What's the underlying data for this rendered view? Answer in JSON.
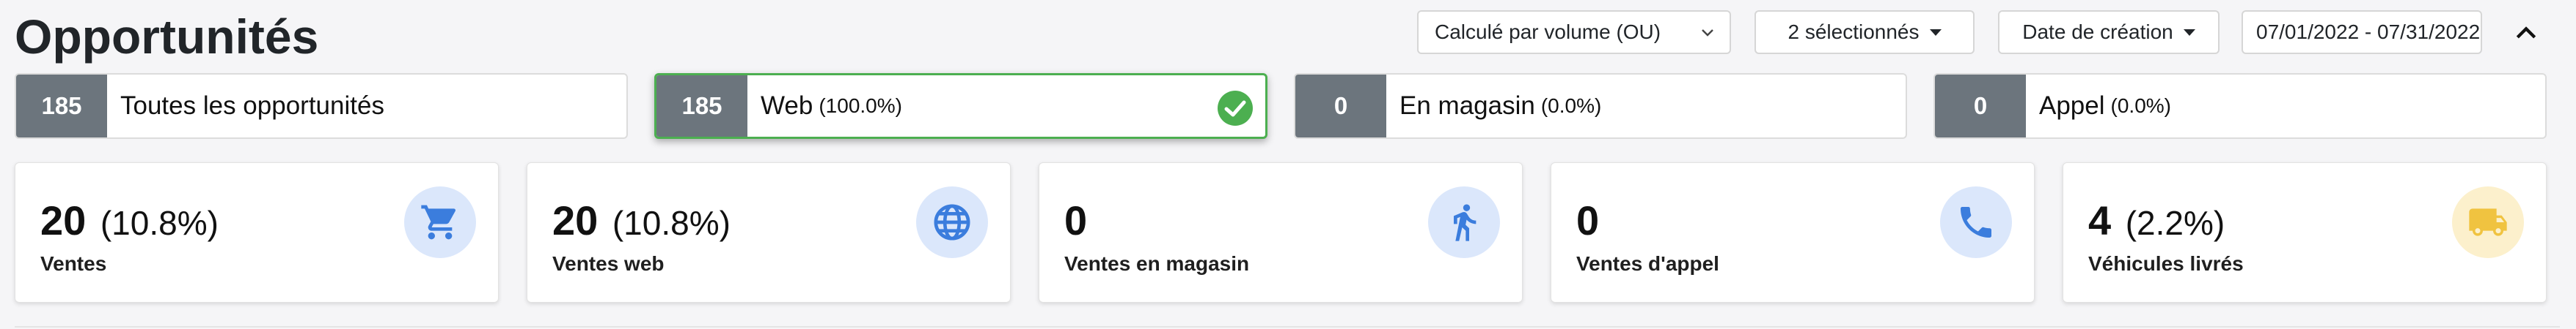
{
  "header": {
    "title": "Opportunités",
    "volume_select": "Calculé par volume (OU)",
    "selected_dropdown": "2 sélectionnés",
    "date_type_dropdown": "Date de création",
    "date_range": "07/01/2022 - 07/31/2022"
  },
  "tiles": [
    {
      "count": "185",
      "label": "Toutes les opportunités",
      "pct": "",
      "active": false
    },
    {
      "count": "185",
      "label": "Web",
      "pct": "(100.0%)",
      "active": true
    },
    {
      "count": "0",
      "label": "En magasin",
      "pct": "(0.0%)",
      "active": false
    },
    {
      "count": "0",
      "label": "Appel",
      "pct": "(0.0%)",
      "active": false
    }
  ],
  "cards": [
    {
      "value": "20",
      "pct": "(10.8%)",
      "label": "Ventes",
      "icon": "cart-icon",
      "icon_color": "#3b7ddd",
      "circle_color": "#dbe7fb"
    },
    {
      "value": "20",
      "pct": "(10.8%)",
      "label": "Ventes web",
      "icon": "globe-icon",
      "icon_color": "#3b7ddd",
      "circle_color": "#dbe7fb"
    },
    {
      "value": "0",
      "pct": "",
      "label": "Ventes en magasin",
      "icon": "walking-person-icon",
      "icon_color": "#3b7ddd",
      "circle_color": "#dbe7fb"
    },
    {
      "value": "0",
      "pct": "",
      "label": "Ventes d'appel",
      "icon": "phone-icon",
      "icon_color": "#3b7ddd",
      "circle_color": "#dbe7fb"
    },
    {
      "value": "4",
      "pct": "(2.2%)",
      "label": "Véhicules livrés",
      "icon": "truck-icon",
      "icon_color": "#f0c340",
      "circle_color": "#fcf0cc"
    }
  ],
  "colors": {
    "active_border": "#4caf50",
    "count_bg": "#6c757d"
  }
}
